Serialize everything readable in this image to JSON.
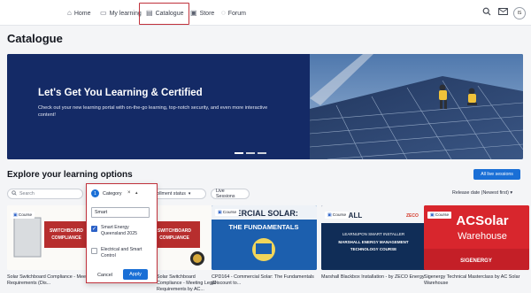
{
  "nav": {
    "items": [
      {
        "label": "Home",
        "icon": "home-icon"
      },
      {
        "label": "My learning",
        "icon": "book-icon"
      },
      {
        "label": "Catalogue",
        "icon": "catalogue-icon"
      },
      {
        "label": "Store",
        "icon": "store-icon"
      },
      {
        "label": "Forum",
        "icon": "forum-icon"
      }
    ],
    "active": "Catalogue",
    "avatar_initials": "IS"
  },
  "page_title": "Catalogue",
  "banner": {
    "title": "Let's Get You Learning & Certified",
    "text": "Check out your new learning portal with on-the-go learning, top-notch security, and even more interactive content!"
  },
  "explore": {
    "heading": "Explore your learning options",
    "all_live_sessions": "All live sessions"
  },
  "filters": {
    "search_placeholder": "Search",
    "category_label": "Category",
    "category_count": "1",
    "enrollment_label": "Enrollment status",
    "live_sessions_label": "Live Sessions",
    "sort_label": "Release date (Newest first)"
  },
  "category_popup": {
    "search_value": "Smart",
    "options": [
      {
        "label": "Smart Energy Queensland 2025",
        "checked": true
      },
      {
        "label": "Electrical and Smart Control",
        "checked": false
      }
    ],
    "cancel_label": "Cancel",
    "apply_label": "Apply"
  },
  "cards": [
    {
      "badge": "Course",
      "title": "Solar Switchboard Compliance - Meeting Legal Requirements (Dis...",
      "thumb_text": "SWITCHBOARD COMPLIANCE"
    },
    {
      "badge": "Course",
      "title": "Solar Switchboard Compliance - Meeting Legal Requirements by AC...",
      "thumb_text": "SWITCHBOARD COMPLIANCE"
    },
    {
      "badge": "Course",
      "title": "CPD164 - Commercial Solar: The Fundamentals (Discount to...",
      "thumb_text": "MERCIAL SOLAR: THE FUNDAMENTALS"
    },
    {
      "badge": "Course",
      "title": "Marshall Blackbox Installation - by ZECO Energy",
      "thumb_text": "LEARNUPON SMART INSTALLER MARSHALL ENERGY MANAGEMENT TECHNOLOGY COURSE"
    },
    {
      "badge": "Course",
      "title": "Sigenergy Technical Masterclass by AC Solar Warehouse",
      "thumb_text": "ACSolar Warehouse"
    }
  ],
  "colors": {
    "accent": "#1a6fd6",
    "highlight_border": "#c0313b",
    "banner_bg": "#142a66"
  }
}
